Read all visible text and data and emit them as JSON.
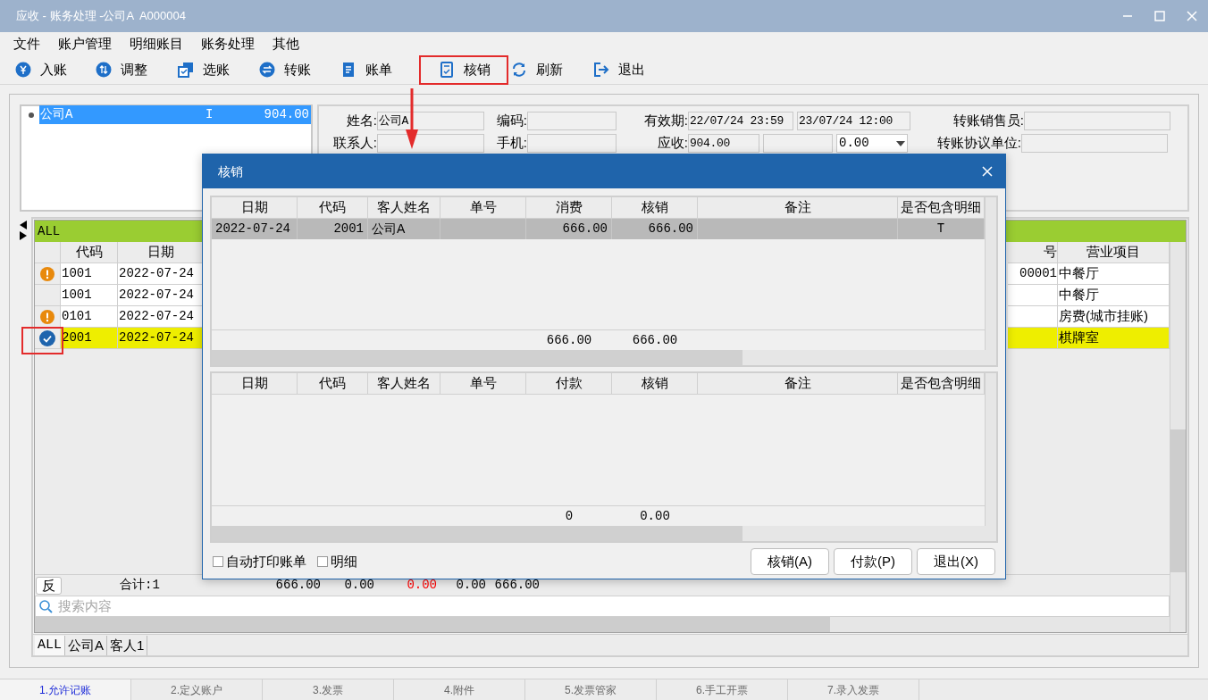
{
  "window": {
    "title": "应收 - 账务处理 -公司A  A000004"
  },
  "menu": [
    "文件",
    "账户管理",
    "明细账目",
    "账务处理",
    "其他"
  ],
  "toolbar": [
    {
      "label": "入账",
      "highlighted": false
    },
    {
      "label": "调整",
      "highlighted": false
    },
    {
      "label": "选账",
      "highlighted": false
    },
    {
      "label": "转账",
      "highlighted": false
    },
    {
      "label": "账单",
      "highlighted": false
    },
    {
      "label": "核销",
      "highlighted": true
    },
    {
      "label": "刷新",
      "highlighted": false
    },
    {
      "label": "退出",
      "highlighted": false
    }
  ],
  "account_list": [
    {
      "name": "公司A",
      "flag": "I",
      "amount": "904.00",
      "selected": true
    }
  ],
  "info_rows": [
    {
      "groups": [
        {
          "label": "姓名:",
          "fields": [
            {
              "kind": "text",
              "value": "公司A"
            }
          ]
        },
        {
          "label": "编码:",
          "fields": [
            {
              "kind": "text"
            }
          ]
        },
        {
          "label": "有效期:",
          "fields": [
            {
              "kind": "text",
              "value": "22/07/24 23:59"
            },
            {
              "kind": "text",
              "value": "23/07/24 12:00"
            }
          ]
        },
        {
          "label": "转账销售员:",
          "fields": [
            {
              "kind": "text"
            }
          ]
        }
      ]
    },
    {
      "groups": [
        {
          "label": "联系人:",
          "fields": [
            {
              "kind": "text"
            }
          ]
        },
        {
          "label": "手机:",
          "fields": [
            {
              "kind": "text"
            }
          ]
        },
        {
          "label": "应收:",
          "fields": [
            {
              "kind": "text",
              "value": "904.00"
            },
            {
              "kind": "text"
            },
            {
              "kind": "dropdown",
              "value": "0.00"
            }
          ]
        },
        {
          "label": "转账协议单位:",
          "fields": [
            {
              "kind": "text"
            }
          ]
        }
      ]
    }
  ],
  "main_grid": {
    "group": "ALL",
    "columns": [
      "代码",
      "日期",
      "号",
      "营业项目"
    ],
    "rows": [
      {
        "warning": true,
        "checked": false,
        "code": "1001",
        "date": "2022-07-24",
        "column_3": "00001",
        "item": "中餐厅",
        "selected": false
      },
      {
        "warning": false,
        "checked": false,
        "code": "1001",
        "date": "2022-07-24",
        "item": "中餐厅",
        "selected": false
      },
      {
        "warning": true,
        "checked": false,
        "code": "0101",
        "date": "2022-07-24",
        "item": "房费(城市挂账)",
        "selected": false
      },
      {
        "warning": false,
        "checked": true,
        "code": "2001",
        "date": "2022-07-24",
        "item": "棋牌室",
        "selected": true
      }
    ],
    "reverse_button": "反",
    "count": "合计:1",
    "totals": [
      {
        "value": "666.00",
        "color": "#000000"
      },
      {
        "value": "0.00",
        "color": "#000000"
      },
      {
        "value": "0.00",
        "color": "#ff0000"
      },
      {
        "value": "0.00",
        "color": "#000000"
      },
      {
        "value": "666.00",
        "color": "#000000"
      }
    ],
    "search": {
      "placeholder": "搜索内容"
    },
    "tabs": [
      {
        "label": "ALL",
        "selected": true
      },
      {
        "label": "公司A",
        "selected": false
      },
      {
        "label": "客人1",
        "selected": false
      }
    ]
  },
  "dialog": {
    "title": "核销",
    "upper": {
      "columns": [
        "日期",
        "代码",
        "客人姓名",
        "单号",
        "消费",
        "核销",
        "备注",
        "是否包含明细"
      ],
      "rows": [
        {
          "cells": [
            "2022-07-24",
            "2001",
            "公司A",
            "",
            "666.00",
            "666.00",
            "",
            "T"
          ],
          "selected": true
        }
      ],
      "totals": {
        "column_5": "666.00",
        "column_6": "666.00"
      }
    },
    "lower": {
      "columns": [
        "日期",
        "代码",
        "客人姓名",
        "单号",
        "付款",
        "核销",
        "备注",
        "是否包含明细"
      ],
      "totals": {
        "column_5": "0",
        "column_6": "0.00"
      }
    },
    "checkboxes": [
      {
        "label": "自动打印账单",
        "checked": false
      },
      {
        "label": "明细",
        "checked": false
      }
    ],
    "buttons": [
      "核销(A)",
      "付款(P)",
      "退出(X)"
    ]
  },
  "status_tabs": [
    {
      "label": "1.允许记账",
      "selected": true
    },
    {
      "label": "2.定义账户",
      "selected": false
    },
    {
      "label": "3.发票",
      "selected": false
    },
    {
      "label": "4.附件",
      "selected": false
    },
    {
      "label": "5.发票管家",
      "selected": false
    },
    {
      "label": "6.手工开票",
      "selected": false
    },
    {
      "label": "7.录入发票",
      "selected": false
    }
  ]
}
